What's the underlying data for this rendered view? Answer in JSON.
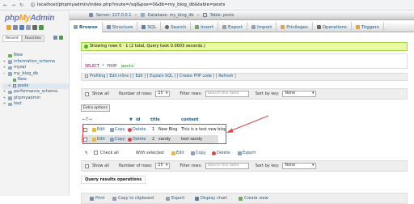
{
  "browser": {
    "url": "localhost/phpmyadmin/index.php?route=/sql&pos=0&db=my_blog_db&table=posts"
  },
  "sidebar": {
    "logo": {
      "php": "php",
      "my": "My",
      "admin": "Admin"
    },
    "tabs": [
      "Recent",
      "Favorites"
    ],
    "tree": [
      {
        "label": "New",
        "level": 0
      },
      {
        "label": "information_schema",
        "level": 0
      },
      {
        "label": "mysql",
        "level": 0
      },
      {
        "label": "my_blog_db",
        "level": 0
      },
      {
        "label": "New",
        "level": 1
      },
      {
        "label": "posts",
        "level": 1
      },
      {
        "label": "performance_schema",
        "level": 0
      },
      {
        "label": "phpmyadmin",
        "level": 0
      },
      {
        "label": "test",
        "level": 0
      }
    ]
  },
  "breadcrumb": {
    "server": "Server: 127.0.0.1",
    "database": "Database: my_blog_db",
    "table": "Table: posts"
  },
  "tabs": [
    "Browse",
    "Structure",
    "SQL",
    "Search",
    "Insert",
    "Export",
    "Import",
    "Privileges",
    "Operations",
    "Triggers"
  ],
  "colors": {
    "accent": "#235a81",
    "success_bg": "#ebf8a4",
    "highlight": "#d94848"
  },
  "success_message": "Showing rows 0 - 1 (2 total, Query took 0.0003 seconds.)",
  "query": {
    "select": "SELECT",
    "star_from": "* FROM",
    "table": "`posts`"
  },
  "query_links": {
    "profiling": "Profiling",
    "links": "[ Edit inline ] [ Edit ] [ Explain SQL ] [ Create PHP code ] [ Refresh ]"
  },
  "nav": {
    "show_all": "Show all",
    "rows_label": "Number of rows:",
    "rows_value": "25",
    "filter_label": "Filter rows:",
    "filter_placeholder": "Search this table",
    "sort_label": "Sort by key:",
    "sort_value": "None"
  },
  "extra_options": "Extra options",
  "table": {
    "headers": [
      "id",
      "title",
      "content"
    ],
    "action_labels": {
      "edit": "Edit",
      "copy": "Copy",
      "delete": "Delete"
    },
    "rows": [
      {
        "id": "1",
        "title": "New Blog",
        "content": "This is a test new blog"
      },
      {
        "id": "2",
        "title": "sandy",
        "content": "test sandy"
      }
    ]
  },
  "bulk": {
    "check_all": "Check all",
    "with_selected": "With selected:",
    "edit": "Edit",
    "copy": "Copy",
    "delete": "Delete",
    "export": "Export"
  },
  "query_results_ops": {
    "title": "Query results operations",
    "items": [
      "Print",
      "Copy to clipboard",
      "Export",
      "Display chart",
      "Create view"
    ]
  }
}
